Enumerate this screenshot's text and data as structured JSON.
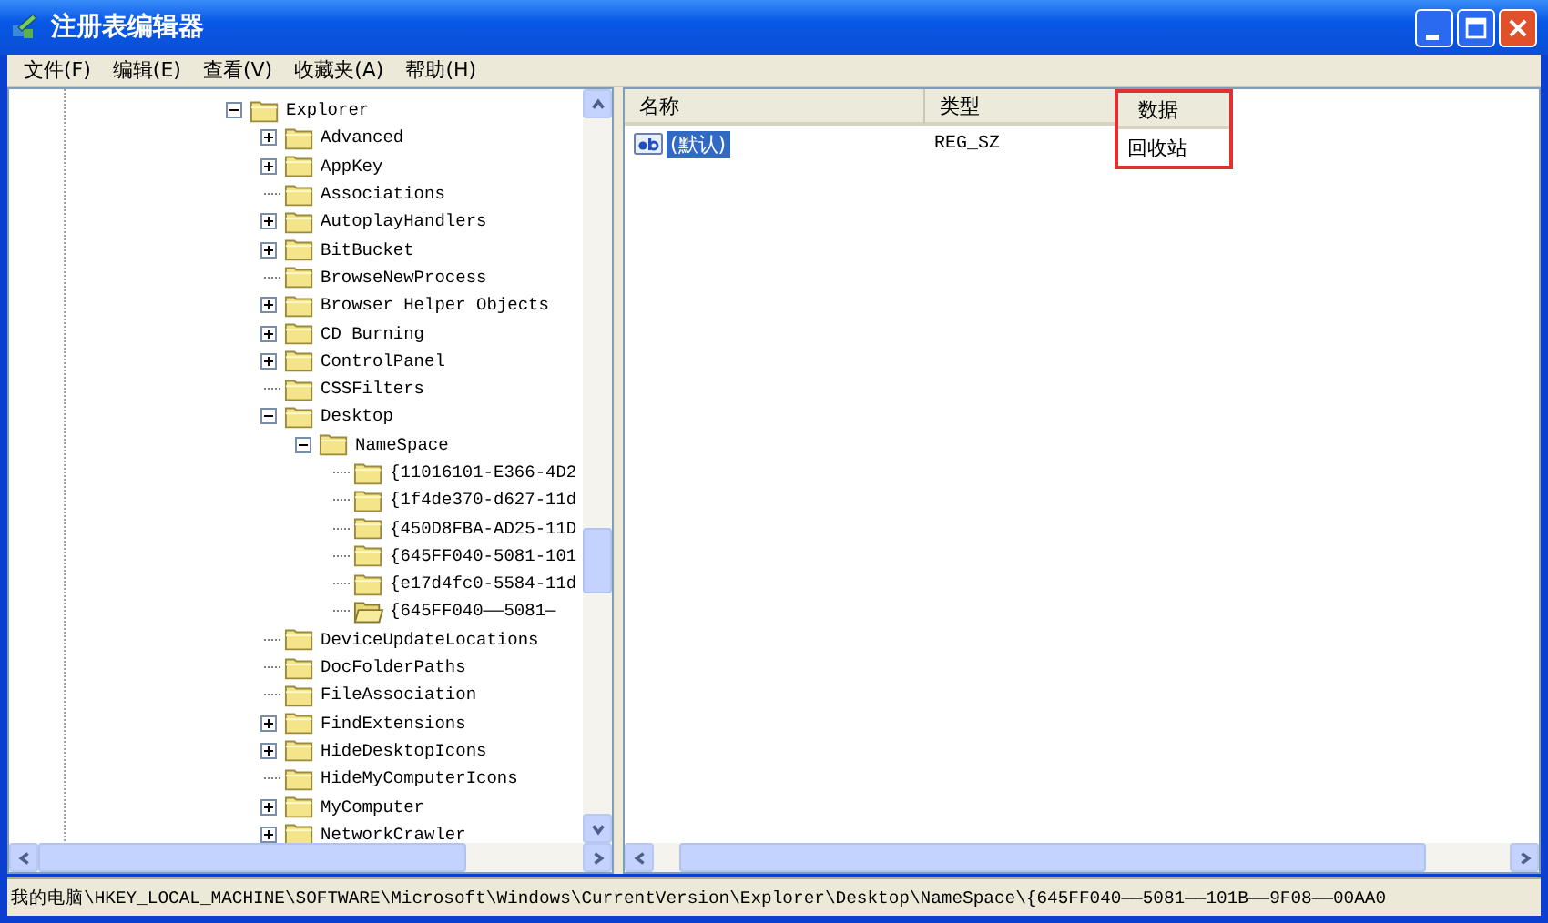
{
  "window": {
    "title": "注册表编辑器"
  },
  "menu": [
    "文件(F)",
    "编辑(E)",
    "查看(V)",
    "收藏夹(A)",
    "帮助(H)"
  ],
  "tree": [
    {
      "label": "Explorer",
      "kind": "expanded",
      "selected": false,
      "children": [
        {
          "label": "Advanced",
          "kind": "collapsed",
          "selected": false
        },
        {
          "label": "AppKey",
          "kind": "collapsed",
          "selected": false
        },
        {
          "label": "Associations",
          "kind": "leaf",
          "selected": false
        },
        {
          "label": "AutoplayHandlers",
          "kind": "collapsed",
          "selected": false
        },
        {
          "label": "BitBucket",
          "kind": "collapsed",
          "selected": false
        },
        {
          "label": "BrowseNewProcess",
          "kind": "leaf",
          "selected": false
        },
        {
          "label": "Browser Helper Objects",
          "kind": "collapsed",
          "selected": false
        },
        {
          "label": "CD Burning",
          "kind": "collapsed",
          "selected": false
        },
        {
          "label": "ControlPanel",
          "kind": "collapsed",
          "selected": false
        },
        {
          "label": "CSSFilters",
          "kind": "leaf",
          "selected": false
        },
        {
          "label": "Desktop",
          "kind": "expanded",
          "selected": false,
          "children": [
            {
              "label": "NameSpace",
              "kind": "expanded",
              "selected": false,
              "children": [
                {
                  "label": "{11016101-E366-4D2",
                  "kind": "leaf",
                  "selected": false
                },
                {
                  "label": "{1f4de370-d627-11d",
                  "kind": "leaf",
                  "selected": false
                },
                {
                  "label": "{450D8FBA-AD25-11D",
                  "kind": "leaf",
                  "selected": false
                },
                {
                  "label": "{645FF040-5081-101",
                  "kind": "leaf",
                  "selected": false
                },
                {
                  "label": "{e17d4fc0-5584-11d",
                  "kind": "leaf",
                  "selected": false
                },
                {
                  "label": "{645FF040——5081—",
                  "kind": "leaf",
                  "selected": true
                }
              ]
            }
          ]
        },
        {
          "label": "DeviceUpdateLocations",
          "kind": "leaf",
          "selected": false
        },
        {
          "label": "DocFolderPaths",
          "kind": "leaf",
          "selected": false
        },
        {
          "label": "FileAssociation",
          "kind": "leaf",
          "selected": false
        },
        {
          "label": "FindExtensions",
          "kind": "collapsed",
          "selected": false
        },
        {
          "label": "HideDesktopIcons",
          "kind": "collapsed",
          "selected": false
        },
        {
          "label": "HideMyComputerIcons",
          "kind": "leaf",
          "selected": false
        },
        {
          "label": "MyComputer",
          "kind": "collapsed",
          "selected": false
        },
        {
          "label": "NetworkCrawler",
          "kind": "collapsed",
          "selected": false
        }
      ]
    }
  ],
  "list": {
    "columns": [
      {
        "label": "名称",
        "highlighted": false
      },
      {
        "label": "类型",
        "highlighted": false
      },
      {
        "label": "数据",
        "highlighted": true
      }
    ],
    "rows": [
      {
        "cells": [
          "(默认)",
          "REG_SZ",
          "回收站"
        ],
        "selected": true
      }
    ]
  },
  "status_bar": "我的电脑\\HKEY_LOCAL_MACHINE\\SOFTWARE\\Microsoft\\Windows\\CurrentVersion\\Explorer\\Desktop\\NameSpace\\{645FF040——5081——101B——9F08——00AA0"
}
